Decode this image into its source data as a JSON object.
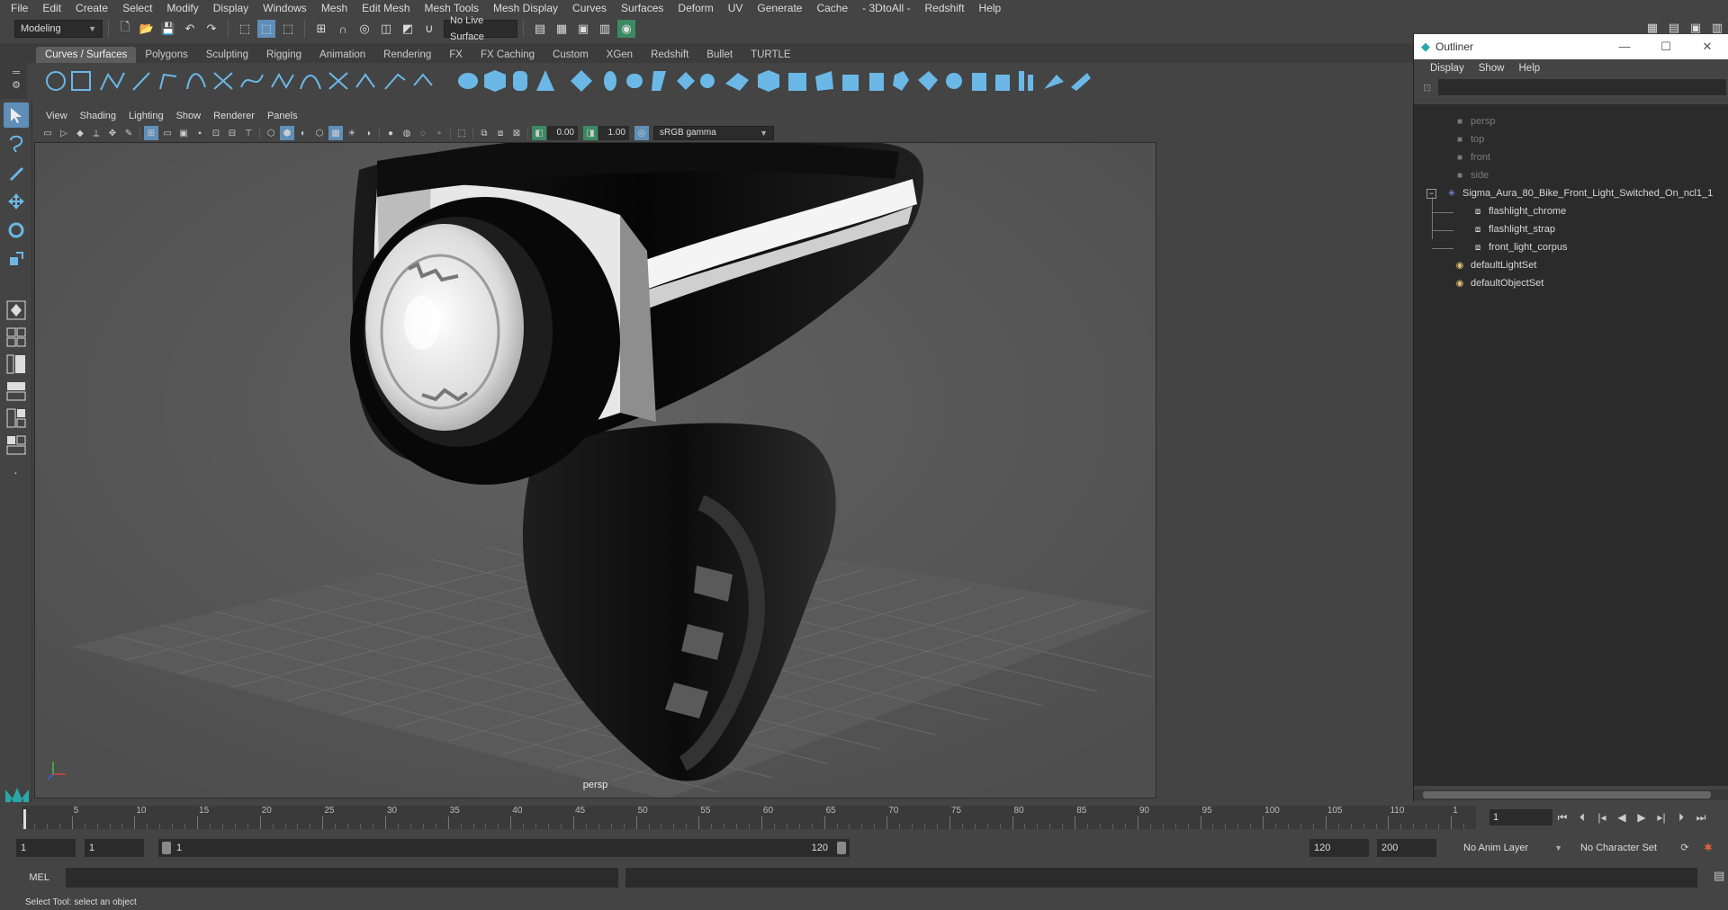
{
  "menubar": [
    "File",
    "Edit",
    "Create",
    "Select",
    "Modify",
    "Display",
    "Windows",
    "Mesh",
    "Edit Mesh",
    "Mesh Tools",
    "Mesh Display",
    "Curves",
    "Surfaces",
    "Deform",
    "UV",
    "Generate",
    "Cache",
    "- 3DtoAll -",
    "Redshift",
    "Help"
  ],
  "statusline": {
    "mode": "Modeling",
    "live_surface": "No Live Surface"
  },
  "shelf_tabs": [
    "Curves / Surfaces",
    "Polygons",
    "Sculpting",
    "Rigging",
    "Animation",
    "Rendering",
    "FX",
    "FX Caching",
    "Custom",
    "XGen",
    "Redshift",
    "Bullet",
    "TURTLE"
  ],
  "viewport": {
    "menu": [
      "View",
      "Shading",
      "Lighting",
      "Show",
      "Renderer",
      "Panels"
    ],
    "exposure": "0.00",
    "gamma": "1.00",
    "color_space": "sRGB gamma",
    "camera_label": "persp"
  },
  "outliner": {
    "title": "Outliner",
    "menu": [
      "Display",
      "Show",
      "Help"
    ],
    "items": [
      {
        "label": "persp",
        "kind": "camera"
      },
      {
        "label": "top",
        "kind": "camera"
      },
      {
        "label": "front",
        "kind": "camera"
      },
      {
        "label": "side",
        "kind": "camera"
      },
      {
        "label": "Sigma_Aura_80_Bike_Front_Light_Switched_On_ncl1_1",
        "kind": "group"
      },
      {
        "label": "flashlight_chrome",
        "kind": "mesh"
      },
      {
        "label": "flashlight_strap",
        "kind": "mesh"
      },
      {
        "label": "front_light_corpus",
        "kind": "mesh"
      },
      {
        "label": "defaultLightSet",
        "kind": "set"
      },
      {
        "label": "defaultObjectSet",
        "kind": "set"
      }
    ]
  },
  "timeline": {
    "ticks": [
      "5",
      "10",
      "15",
      "20",
      "25",
      "30",
      "35",
      "40",
      "45",
      "50",
      "55",
      "60",
      "65",
      "70",
      "75",
      "80",
      "85",
      "90",
      "95",
      "100",
      "105",
      "110",
      "1"
    ],
    "start_label": "1",
    "current_frame": "1"
  },
  "range": {
    "start": "1",
    "playback_start": "1",
    "slider_start": "1",
    "slider_end": "120",
    "playback_end": "120",
    "end": "200",
    "anim_layer": "No Anim Layer",
    "character_set": "No Character Set"
  },
  "cmdline": {
    "label": "MEL"
  },
  "helpline": "Select Tool: select an object",
  "colors": {
    "accent": "#6bb8e6",
    "panel": "#444444",
    "field": "#2b2b2b",
    "viewport_bg": "#5a5a5a"
  }
}
